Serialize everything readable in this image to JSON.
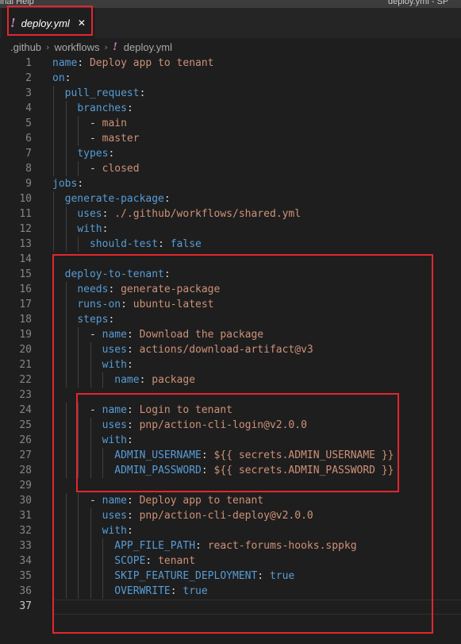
{
  "menubar": {
    "left_text": "inal   Help",
    "right_text": "deploy.yml - SP"
  },
  "tab": {
    "label": "deploy.yml",
    "close_glyph": "✕",
    "icon": "yaml-exclamation-icon"
  },
  "breadcrumb": {
    "items": [
      ".github",
      "workflows",
      "deploy.yml"
    ],
    "separator": "›"
  },
  "editor": {
    "language": "yaml",
    "active_line": 37,
    "lines": [
      {
        "n": "1",
        "t": [
          [
            "k",
            "name"
          ],
          [
            "p",
            ": "
          ],
          [
            "s",
            "Deploy app to tenant"
          ]
        ]
      },
      {
        "n": "2",
        "t": [
          [
            "k",
            "on"
          ],
          [
            "p",
            ":"
          ]
        ]
      },
      {
        "n": "3",
        "t": [
          [
            "p",
            "  "
          ],
          [
            "k",
            "pull_request"
          ],
          [
            "p",
            ":"
          ]
        ]
      },
      {
        "n": "4",
        "t": [
          [
            "p",
            "    "
          ],
          [
            "k",
            "branches"
          ],
          [
            "p",
            ":"
          ]
        ]
      },
      {
        "n": "5",
        "t": [
          [
            "p",
            "      - "
          ],
          [
            "s",
            "main"
          ]
        ]
      },
      {
        "n": "6",
        "t": [
          [
            "p",
            "      - "
          ],
          [
            "s",
            "master"
          ]
        ]
      },
      {
        "n": "7",
        "t": [
          [
            "p",
            "    "
          ],
          [
            "k",
            "types"
          ],
          [
            "p",
            ":"
          ]
        ]
      },
      {
        "n": "8",
        "t": [
          [
            "p",
            "      - "
          ],
          [
            "s",
            "closed"
          ]
        ]
      },
      {
        "n": "9",
        "t": [
          [
            "k",
            "jobs"
          ],
          [
            "p",
            ":"
          ]
        ]
      },
      {
        "n": "10",
        "t": [
          [
            "p",
            "  "
          ],
          [
            "k",
            "generate-package"
          ],
          [
            "p",
            ":"
          ]
        ]
      },
      {
        "n": "11",
        "t": [
          [
            "p",
            "    "
          ],
          [
            "k",
            "uses"
          ],
          [
            "p",
            ": "
          ],
          [
            "s",
            "./.github/workflows/shared.yml"
          ]
        ]
      },
      {
        "n": "12",
        "t": [
          [
            "p",
            "    "
          ],
          [
            "k",
            "with"
          ],
          [
            "p",
            ":"
          ]
        ]
      },
      {
        "n": "13",
        "t": [
          [
            "p",
            "      "
          ],
          [
            "k",
            "should-test"
          ],
          [
            "p",
            ": "
          ],
          [
            "b",
            "false"
          ]
        ]
      },
      {
        "n": "14",
        "t": []
      },
      {
        "n": "15",
        "t": [
          [
            "p",
            "  "
          ],
          [
            "k",
            "deploy-to-tenant"
          ],
          [
            "p",
            ":"
          ]
        ]
      },
      {
        "n": "16",
        "t": [
          [
            "p",
            "    "
          ],
          [
            "k",
            "needs"
          ],
          [
            "p",
            ": "
          ],
          [
            "s",
            "generate-package"
          ]
        ]
      },
      {
        "n": "17",
        "t": [
          [
            "p",
            "    "
          ],
          [
            "k",
            "runs-on"
          ],
          [
            "p",
            ": "
          ],
          [
            "s",
            "ubuntu-latest"
          ]
        ]
      },
      {
        "n": "18",
        "t": [
          [
            "p",
            "    "
          ],
          [
            "k",
            "steps"
          ],
          [
            "p",
            ":"
          ]
        ]
      },
      {
        "n": "19",
        "t": [
          [
            "p",
            "      - "
          ],
          [
            "k",
            "name"
          ],
          [
            "p",
            ": "
          ],
          [
            "s",
            "Download the package"
          ]
        ]
      },
      {
        "n": "20",
        "t": [
          [
            "p",
            "        "
          ],
          [
            "k",
            "uses"
          ],
          [
            "p",
            ": "
          ],
          [
            "s",
            "actions/download-artifact@v3"
          ]
        ]
      },
      {
        "n": "21",
        "t": [
          [
            "p",
            "        "
          ],
          [
            "k",
            "with"
          ],
          [
            "p",
            ":"
          ]
        ]
      },
      {
        "n": "22",
        "t": [
          [
            "p",
            "          "
          ],
          [
            "k",
            "name"
          ],
          [
            "p",
            ": "
          ],
          [
            "s",
            "package"
          ]
        ]
      },
      {
        "n": "23",
        "t": []
      },
      {
        "n": "24",
        "t": [
          [
            "p",
            "      - "
          ],
          [
            "k",
            "name"
          ],
          [
            "p",
            ": "
          ],
          [
            "s",
            "Login to tenant"
          ]
        ]
      },
      {
        "n": "25",
        "t": [
          [
            "p",
            "        "
          ],
          [
            "k",
            "uses"
          ],
          [
            "p",
            ": "
          ],
          [
            "s",
            "pnp/action-cli-login@v2.0.0"
          ]
        ]
      },
      {
        "n": "26",
        "t": [
          [
            "p",
            "        "
          ],
          [
            "k",
            "with"
          ],
          [
            "p",
            ":"
          ]
        ]
      },
      {
        "n": "27",
        "t": [
          [
            "p",
            "          "
          ],
          [
            "k",
            "ADMIN_USERNAME"
          ],
          [
            "p",
            ": "
          ],
          [
            "s",
            "${{ secrets.ADMIN_USERNAME }}"
          ]
        ]
      },
      {
        "n": "28",
        "t": [
          [
            "p",
            "          "
          ],
          [
            "k",
            "ADMIN_PASSWORD"
          ],
          [
            "p",
            ": "
          ],
          [
            "s",
            "${{ secrets.ADMIN_PASSWORD }}"
          ]
        ]
      },
      {
        "n": "29",
        "t": []
      },
      {
        "n": "30",
        "t": [
          [
            "p",
            "      - "
          ],
          [
            "k",
            "name"
          ],
          [
            "p",
            ": "
          ],
          [
            "s",
            "Deploy app to tenant"
          ]
        ]
      },
      {
        "n": "31",
        "t": [
          [
            "p",
            "        "
          ],
          [
            "k",
            "uses"
          ],
          [
            "p",
            ": "
          ],
          [
            "s",
            "pnp/action-cli-deploy@v2.0.0"
          ]
        ]
      },
      {
        "n": "32",
        "t": [
          [
            "p",
            "        "
          ],
          [
            "k",
            "with"
          ],
          [
            "p",
            ":"
          ]
        ]
      },
      {
        "n": "33",
        "t": [
          [
            "p",
            "          "
          ],
          [
            "k",
            "APP_FILE_PATH"
          ],
          [
            "p",
            ": "
          ],
          [
            "s",
            "react-forums-hooks.sppkg"
          ]
        ]
      },
      {
        "n": "34",
        "t": [
          [
            "p",
            "          "
          ],
          [
            "k",
            "SCOPE"
          ],
          [
            "p",
            ": "
          ],
          [
            "s",
            "tenant"
          ]
        ]
      },
      {
        "n": "35",
        "t": [
          [
            "p",
            "          "
          ],
          [
            "k",
            "SKIP_FEATURE_DEPLOYMENT"
          ],
          [
            "p",
            ": "
          ],
          [
            "b",
            "true"
          ]
        ]
      },
      {
        "n": "36",
        "t": [
          [
            "p",
            "          "
          ],
          [
            "k",
            "OVERWRITE"
          ],
          [
            "p",
            ": "
          ],
          [
            "b",
            "true"
          ]
        ]
      },
      {
        "n": "37",
        "t": []
      }
    ]
  },
  "colors": {
    "highlight_box": "#e3262c",
    "keyword": "#569cd6",
    "string": "#ce9178",
    "background": "#1e1e1e"
  }
}
